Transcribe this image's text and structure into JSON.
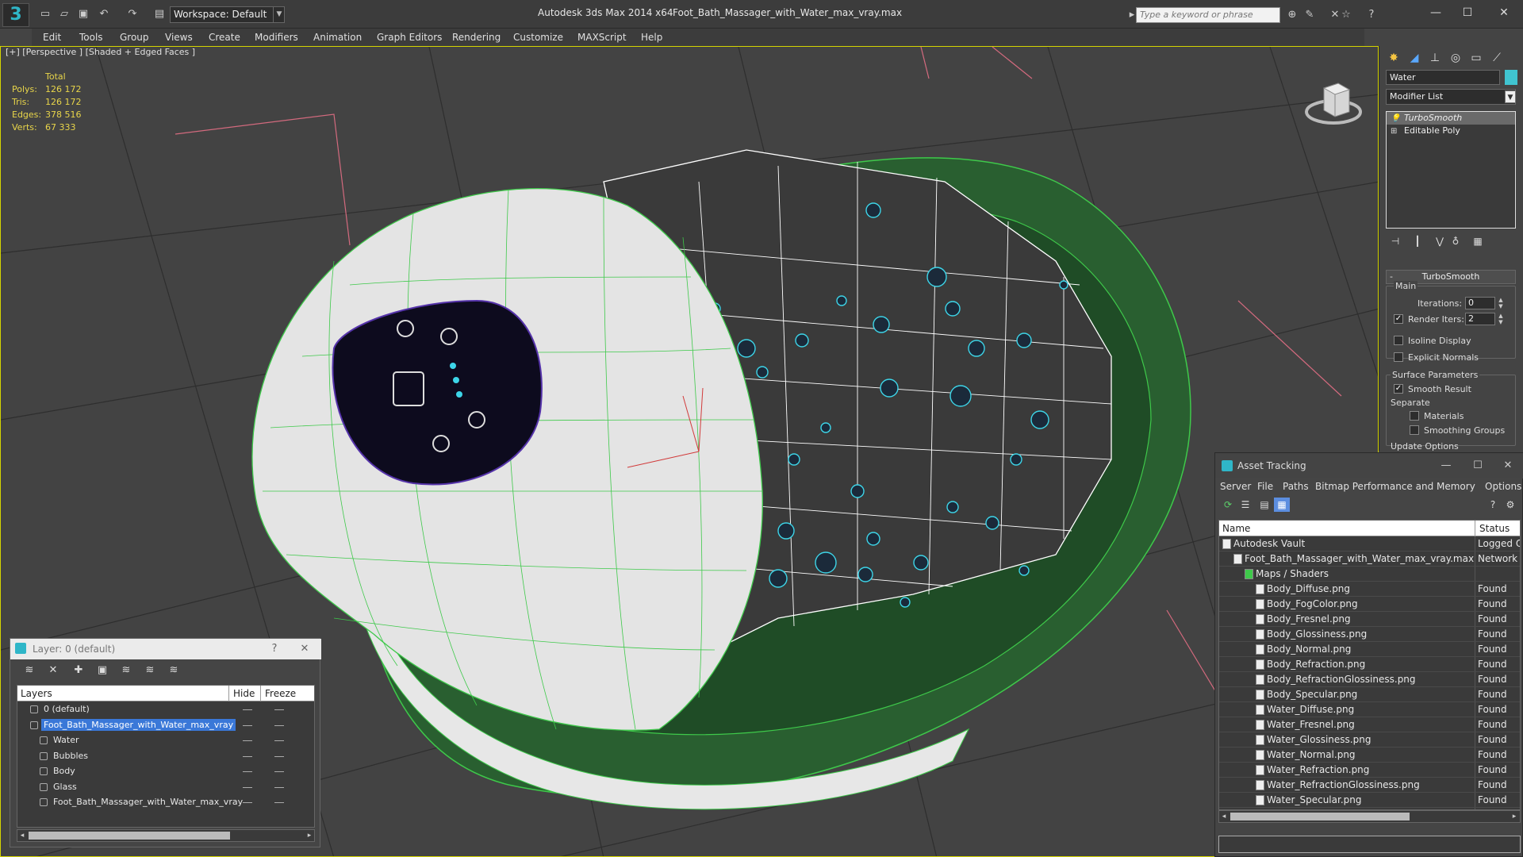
{
  "titlebar": {
    "workspace": "Workspace: Default",
    "app_title": "Autodesk 3ds Max  2014 x64",
    "file_title": "Foot_Bath_Massager_with_Water_max_vray.max",
    "search_placeholder": "Type a keyword or phrase"
  },
  "menu": [
    "Edit",
    "Tools",
    "Group",
    "Views",
    "Create",
    "Modifiers",
    "Animation",
    "Graph Editors",
    "Rendering",
    "Customize",
    "MAXScript",
    "Help"
  ],
  "viewport": {
    "label": "[+] [Perspective ] [Shaded + Edged Faces ]",
    "stats": {
      "header": "Total",
      "rows": [
        {
          "label": "Polys:",
          "value": "126 172"
        },
        {
          "label": "Tris:",
          "value": "126 172"
        },
        {
          "label": "Edges:",
          "value": "378 516"
        },
        {
          "label": "Verts:",
          "value": "67 333"
        }
      ]
    }
  },
  "command_panel": {
    "object_name": "Water",
    "object_color": "#40c4d0",
    "modifier_list": "Modifier List",
    "stack": [
      "TurboSmooth",
      "Editable Poly"
    ],
    "rollout_title": "TurboSmooth",
    "main_group": "Main",
    "iterations_label": "Iterations:",
    "iterations_value": "0",
    "render_iters_label": "Render Iters:",
    "render_iters_value": "2",
    "render_iters_checked": true,
    "isoline_label": "Isoline Display",
    "explicit_label": "Explicit Normals",
    "surface_group": "Surface Parameters",
    "smooth_result_label": "Smooth Result",
    "separate_label": "Separate",
    "materials_label": "Materials",
    "smoothing_groups_label": "Smoothing Groups",
    "update_label": "Update Options"
  },
  "asset_tracking": {
    "title": "Asset Tracking",
    "menu": [
      "Server",
      "File",
      "Paths",
      "Bitmap Performance and Memory",
      "Options"
    ],
    "col_name": "Name",
    "col_status": "Status",
    "rows": [
      {
        "name": "Autodesk Vault",
        "status": "Logged Out",
        "indent": 1
      },
      {
        "name": "Foot_Bath_Massager_with_Water_max_vray.max",
        "status": "Network Path",
        "indent": 2
      },
      {
        "name": "Maps / Shaders",
        "status": "",
        "indent": 3
      },
      {
        "name": "Body_Diffuse.png",
        "status": "Found",
        "indent": 4
      },
      {
        "name": "Body_FogColor.png",
        "status": "Found",
        "indent": 4
      },
      {
        "name": "Body_Fresnel.png",
        "status": "Found",
        "indent": 4
      },
      {
        "name": "Body_Glossiness.png",
        "status": "Found",
        "indent": 4
      },
      {
        "name": "Body_Normal.png",
        "status": "Found",
        "indent": 4
      },
      {
        "name": "Body_Refraction.png",
        "status": "Found",
        "indent": 4
      },
      {
        "name": "Body_RefractionGlossiness.png",
        "status": "Found",
        "indent": 4
      },
      {
        "name": "Body_Specular.png",
        "status": "Found",
        "indent": 4
      },
      {
        "name": "Water_Diffuse.png",
        "status": "Found",
        "indent": 4
      },
      {
        "name": "Water_Fresnel.png",
        "status": "Found",
        "indent": 4
      },
      {
        "name": "Water_Glossiness.png",
        "status": "Found",
        "indent": 4
      },
      {
        "name": "Water_Normal.png",
        "status": "Found",
        "indent": 4
      },
      {
        "name": "Water_Refraction.png",
        "status": "Found",
        "indent": 4
      },
      {
        "name": "Water_RefractionGlossiness.png",
        "status": "Found",
        "indent": 4
      },
      {
        "name": "Water_Specular.png",
        "status": "Found",
        "indent": 4
      }
    ]
  },
  "layer_explorer": {
    "title": "Layer: 0 (default)",
    "help": "?",
    "col_layers": "Layers",
    "col_hide": "Hide",
    "col_freeze": "Freeze",
    "rows": [
      {
        "name": "0 (default)",
        "indent": 1,
        "selected": false
      },
      {
        "name": "Foot_Bath_Massager_with_Water_max_vray",
        "indent": 1,
        "selected": true
      },
      {
        "name": "Water",
        "indent": 2,
        "selected": false
      },
      {
        "name": "Bubbles",
        "indent": 2,
        "selected": false
      },
      {
        "name": "Body",
        "indent": 2,
        "selected": false
      },
      {
        "name": "Glass",
        "indent": 2,
        "selected": false
      },
      {
        "name": "Foot_Bath_Massager_with_Water_max_vray",
        "indent": 2,
        "selected": false
      }
    ]
  },
  "colors": {
    "accent": "#2fb6c8",
    "selection": "#3a78d8",
    "viewport_border": "#d4d400",
    "wire_green": "#3ec94a",
    "bath_green": "#2b6b35"
  }
}
